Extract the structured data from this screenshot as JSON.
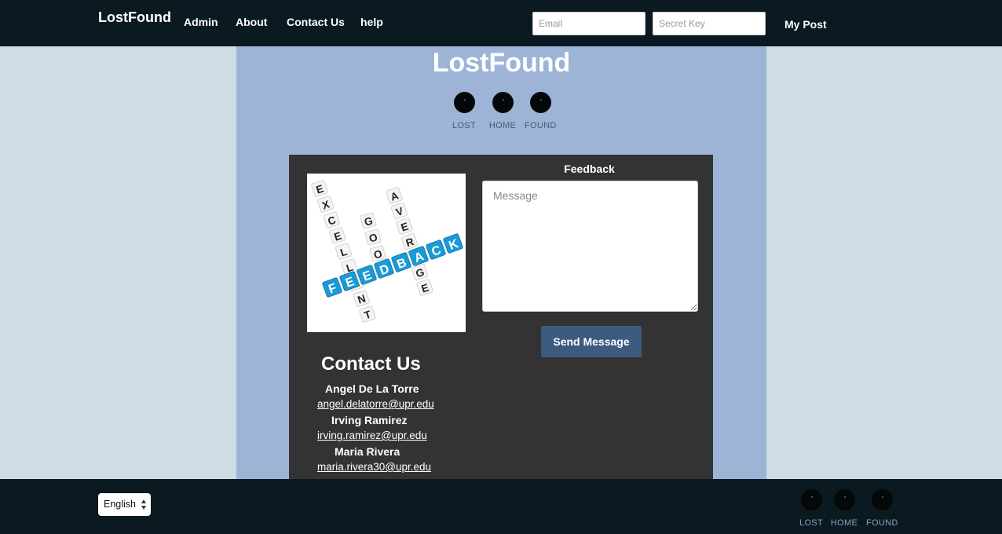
{
  "nav": {
    "brand": "LostFound",
    "links": [
      "Admin",
      "About",
      "Contact Us",
      "help"
    ],
    "email_placeholder": "Email",
    "key_placeholder": "Secret Key",
    "my_post": "My Post"
  },
  "main": {
    "title": "LostFound",
    "dot_nav": [
      "LOST",
      "HOME",
      "FOUND"
    ]
  },
  "feedback": {
    "heading": "Feedback",
    "message_placeholder": "Message",
    "send_label": "Send Message",
    "image_words": {
      "excellent": "EXCELLENT",
      "good": "GOOD",
      "average": "AVERAGE",
      "feedback": "FEEDBACK"
    }
  },
  "contact": {
    "title": "Contact Us",
    "people": [
      {
        "name": "Angel De La Torre",
        "email": "angel.delatorre@upr.edu"
      },
      {
        "name": "Irving Ramirez",
        "email": "irving.ramirez@upr.edu"
      },
      {
        "name": "Maria Rivera",
        "email": "maria.rivera30@upr.edu"
      }
    ]
  },
  "footer": {
    "language": "English",
    "dot_nav": [
      "LOST",
      "HOME",
      "FOUND"
    ]
  },
  "colors": {
    "nav_bg": "#0b1921",
    "page_bg": "#cfdbe5",
    "main_bg": "#9db4d7",
    "panel_bg": "#333333",
    "button_bg": "#3d5a80",
    "tile_blue": "#1a9ad6"
  }
}
